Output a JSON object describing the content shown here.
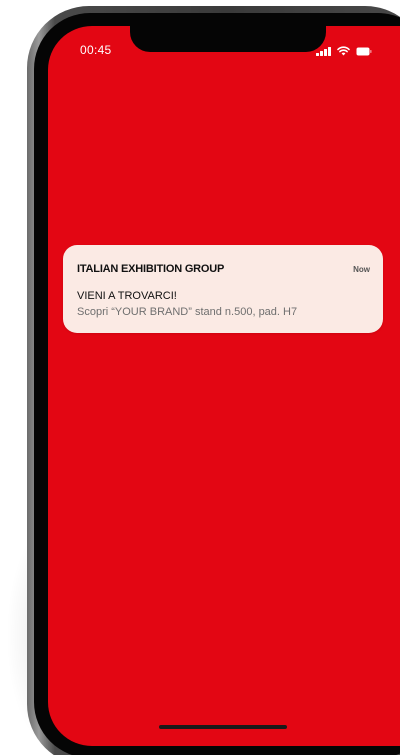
{
  "status_bar": {
    "time": "00:45",
    "icons": [
      "signal-icon",
      "wifi-icon",
      "battery-icon"
    ]
  },
  "notification": {
    "app_name": "ITALIAN EXHIBITION GROUP",
    "time": "Now",
    "title": "VIENI A TROVARCI!",
    "body": "Scopri “YOUR BRAND” stand n.500, pad. H7"
  },
  "colors": {
    "screen_background": "#e30613",
    "notification_background": "#fbeae4"
  }
}
